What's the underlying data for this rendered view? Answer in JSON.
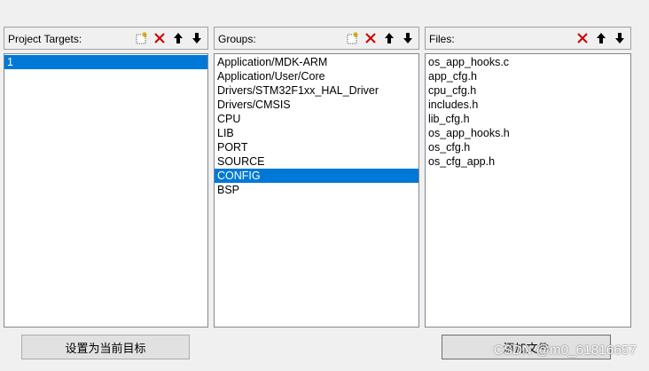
{
  "targets_panel": {
    "title": "Project Targets:",
    "items": [
      "1"
    ],
    "selected_index": 0
  },
  "groups_panel": {
    "title": "Groups:",
    "items": [
      "Application/MDK-ARM",
      "Application/User/Core",
      "Drivers/STM32F1xx_HAL_Driver",
      "Drivers/CMSIS",
      "CPU",
      "LIB",
      "PORT",
      "SOURCE",
      "CONFIG",
      "BSP"
    ],
    "selected_index": 8
  },
  "files_panel": {
    "title": "Files:",
    "items": [
      "os_app_hooks.c",
      "app_cfg.h",
      "cpu_cfg.h",
      "includes.h",
      "lib_cfg.h",
      "os_app_hooks.h",
      "os_cfg.h",
      "os_cfg_app.h"
    ]
  },
  "buttons": {
    "set_target": "设置为当前目标",
    "add_files": "添加文件"
  },
  "watermark": "CSDN @m0_61816657",
  "icons": {
    "new": "new-item-icon",
    "delete": "delete-icon",
    "up": "move-up-icon",
    "down": "move-down-icon"
  },
  "colors": {
    "selection": "#0078d7",
    "delete_red": "#cc0000"
  }
}
